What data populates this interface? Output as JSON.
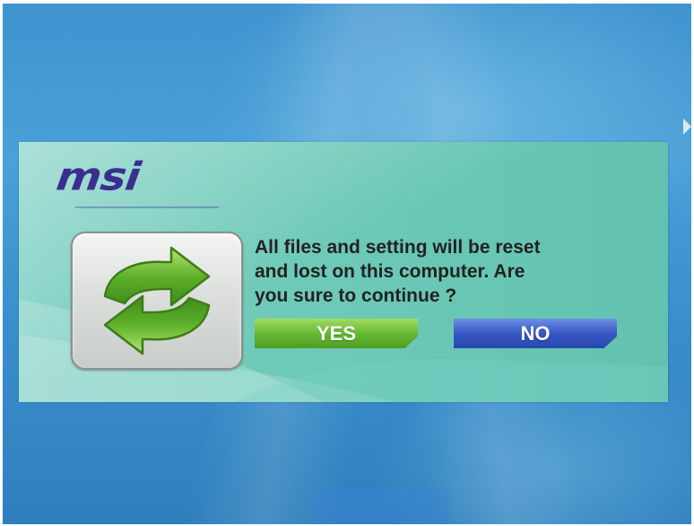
{
  "dialog": {
    "brand": "msi",
    "message": "All files and setting will be reset\nand lost on this computer. Are\nyou sure to continue ?",
    "yes_label": "YES",
    "no_label": "NO",
    "icon": "refresh-arrows-icon"
  },
  "colors": {
    "desktop_background": "#3f93cf",
    "dialog_background": "#6fcab9",
    "brand": "#3a2f8e",
    "yes_button": "#66b932",
    "no_button": "#3557c4",
    "message_text": "#222222"
  }
}
